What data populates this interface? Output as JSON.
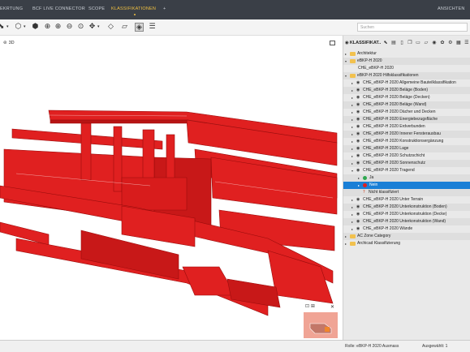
{
  "menubar": {
    "tabs": [
      {
        "label": "EKRTUNG",
        "active": false
      },
      {
        "label": "BCF LIVE CONNECTOR",
        "active": false
      },
      {
        "label": "SCOPE",
        "active": false
      },
      {
        "label": "KLASSIFIKATIONEN",
        "active": true
      },
      {
        "label": "+",
        "active": false
      }
    ],
    "right_label": "ANSICHTEN"
  },
  "toolbar": {
    "search_placeholder": "Suchen"
  },
  "viewport": {
    "label": "3D",
    "model_color": "#e02020"
  },
  "panel": {
    "title": "KLASSIFIKAT..",
    "tree": [
      {
        "level": 0,
        "arrow": "▸",
        "icon": "folder",
        "label": "Architektur"
      },
      {
        "level": 0,
        "arrow": "▾",
        "icon": "folder",
        "label": "eBKP-H 2020"
      },
      {
        "level": 1,
        "arrow": "",
        "icon": "none",
        "label": "CHE_eBKP-H 2020"
      },
      {
        "level": 0,
        "arrow": "▾",
        "icon": "folder",
        "label": "eBKP-H 2020 Hilfsklassifikationen"
      },
      {
        "level": 1,
        "arrow": "▸",
        "icon": "eye",
        "label": "CHE_eBKP-H 2020 Allgemeine Bauteilklassifikation"
      },
      {
        "level": 1,
        "arrow": "▸",
        "icon": "eye",
        "label": "CHE_eBKP-H 2020 Beläge (Boden)"
      },
      {
        "level": 1,
        "arrow": "▸",
        "icon": "eye",
        "label": "CHE_eBKP-H 2020 Beläge (Decken)"
      },
      {
        "level": 1,
        "arrow": "▸",
        "icon": "eye",
        "label": "CHE_eBKP-H 2020 Beläge (Wand)"
      },
      {
        "level": 1,
        "arrow": "▸",
        "icon": "eye",
        "label": "CHE_eBKP-H 2020 Dächer und Decken"
      },
      {
        "level": 1,
        "arrow": "▸",
        "icon": "eye",
        "label": "CHE_eBKP-H 2020 Energiebezugsfläche"
      },
      {
        "level": 1,
        "arrow": "▸",
        "icon": "eye",
        "label": "CHE_eBKP-H 2020 Erdverbunden"
      },
      {
        "level": 1,
        "arrow": "▸",
        "icon": "eye",
        "label": "CHE_eBKP-H 2020 Innerer Fensterausbau"
      },
      {
        "level": 1,
        "arrow": "▸",
        "icon": "eye",
        "label": "CHE_eBKP-H 2020 Konstruktionsergänzung"
      },
      {
        "level": 1,
        "arrow": "▸",
        "icon": "eye",
        "label": "CHE_eBKP-H 2020 Lage"
      },
      {
        "level": 1,
        "arrow": "▸",
        "icon": "eye",
        "label": "CHE_eBKP-H 2020 Schutzschicht"
      },
      {
        "level": 1,
        "arrow": "▸",
        "icon": "eye",
        "label": "CHE_eBKP-H 2020 Sonnenschutz"
      },
      {
        "level": 1,
        "arrow": "▾",
        "icon": "eye",
        "label": "CHE_eBKP-H 2020 Tragend"
      },
      {
        "level": 2,
        "arrow": "▸",
        "icon": "green",
        "label": "Ja"
      },
      {
        "level": 2,
        "arrow": "▸",
        "icon": "red",
        "label": "Nein",
        "selected": true
      },
      {
        "level": 2,
        "arrow": "",
        "icon": "question",
        "label": "Nicht klassifiziert"
      },
      {
        "level": 1,
        "arrow": "▸",
        "icon": "eye",
        "label": "CHE_eBKP-H 2020 Unter Terrain"
      },
      {
        "level": 1,
        "arrow": "▸",
        "icon": "eye",
        "label": "CHE_eBKP-H 2020 Unterkonstruktion (Boden)"
      },
      {
        "level": 1,
        "arrow": "▸",
        "icon": "eye",
        "label": "CHE_eBKP-H 2020 Unterkonstruktion (Decke)"
      },
      {
        "level": 1,
        "arrow": "▸",
        "icon": "eye",
        "label": "CHE_eBKP-H 2020 Unterkonstruktion (Wand)"
      },
      {
        "level": 1,
        "arrow": "▸",
        "icon": "eye",
        "label": "CHE_eBKP-H 2020 Wände"
      },
      {
        "level": 0,
        "arrow": "▸",
        "icon": "folder",
        "label": "AC Zone Category"
      },
      {
        "level": 0,
        "arrow": "▸",
        "icon": "folder",
        "label": "Archicad Klassifizierung"
      }
    ]
  },
  "statusbar": {
    "role": "Rolle: eBKP-H 2020 Ausmass",
    "selection": "Ausgewählt: 1"
  }
}
